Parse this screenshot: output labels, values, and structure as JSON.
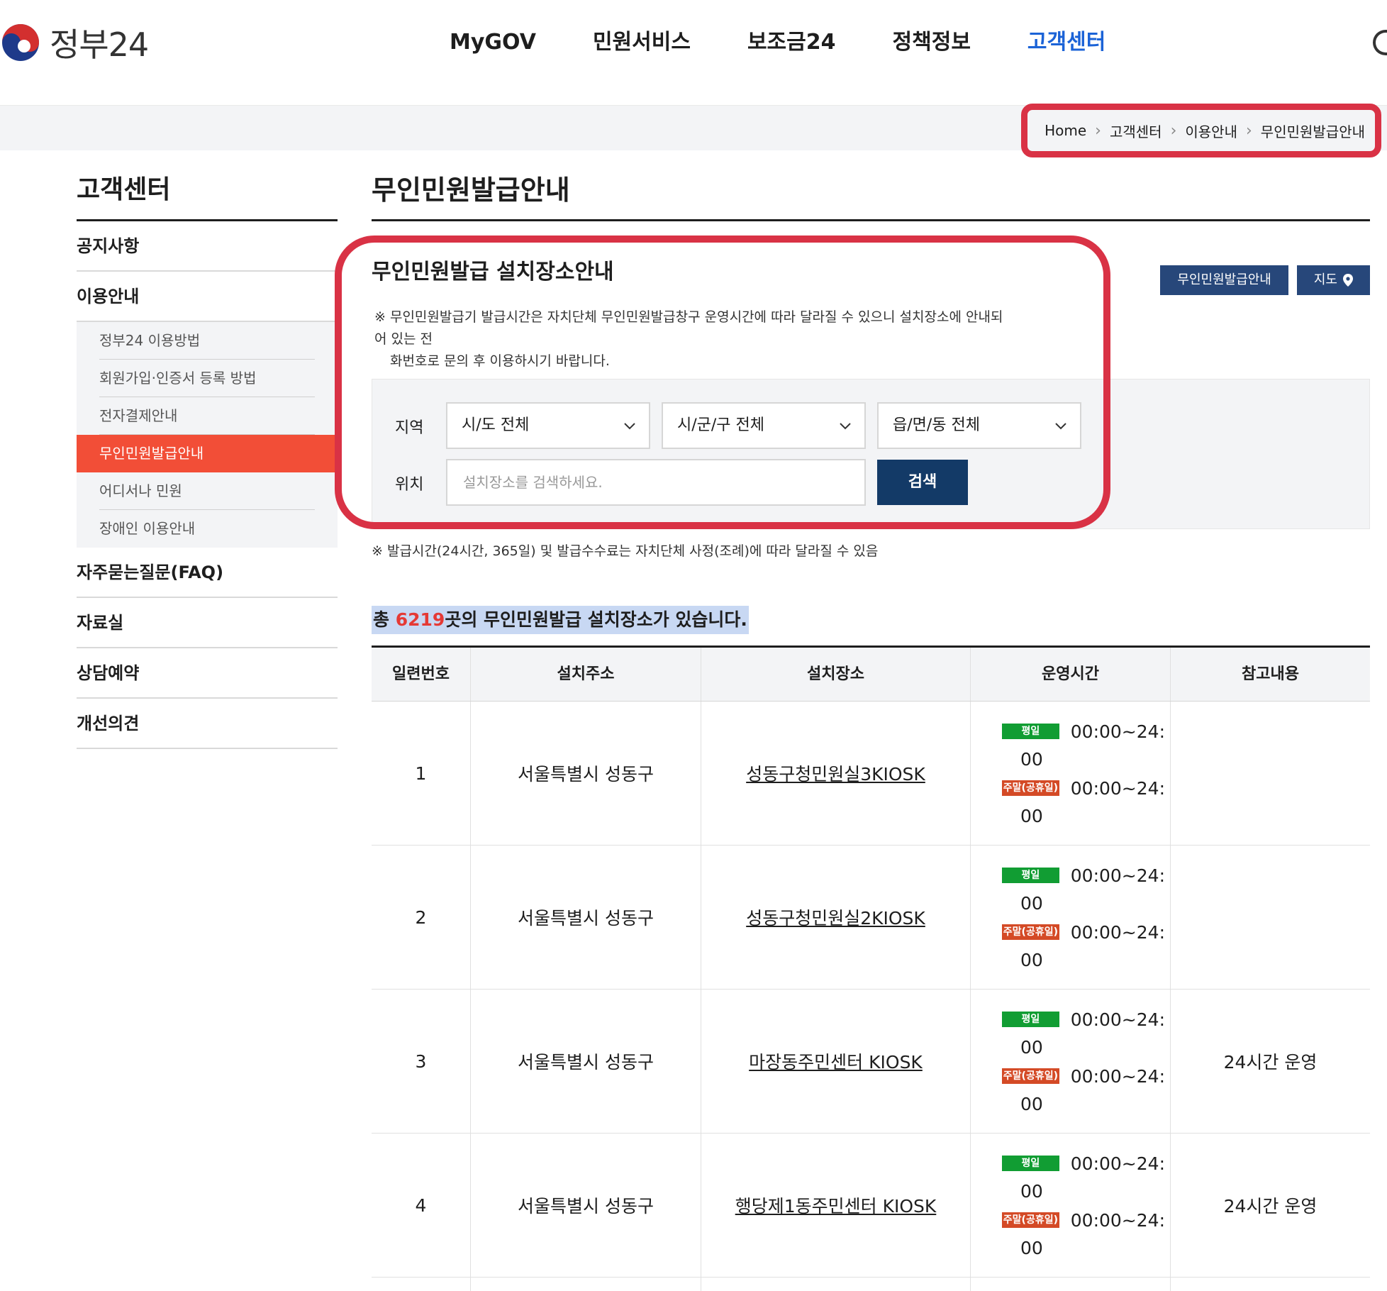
{
  "header": {
    "logo_text": "정부24",
    "nav": [
      {
        "label": "MyGOV",
        "active": false
      },
      {
        "label": "민원서비스",
        "active": false
      },
      {
        "label": "보조금24",
        "active": false
      },
      {
        "label": "정책정보",
        "active": false
      },
      {
        "label": "고객센터",
        "active": true
      }
    ]
  },
  "breadcrumb": [
    "Home",
    "고객센터",
    "이용안내",
    "무인민원발급안내"
  ],
  "sidebar": {
    "title": "고객센터",
    "items": [
      {
        "label": "공지사항"
      },
      {
        "label": "이용안내"
      },
      {
        "label": "자주묻는질문(FAQ)"
      },
      {
        "label": "자료실"
      },
      {
        "label": "상담예약"
      },
      {
        "label": "개선의견"
      }
    ],
    "sub_items": [
      {
        "label": "정부24 이용방법",
        "active": false
      },
      {
        "label": "회원가입·인증서 등록 방법",
        "active": false
      },
      {
        "label": "전자결제안내",
        "active": false
      },
      {
        "label": "무인민원발급안내",
        "active": true
      },
      {
        "label": "어디서나 민원",
        "active": false
      },
      {
        "label": "장애인 이용안내",
        "active": false
      }
    ]
  },
  "main": {
    "page_title": "무인민원발급안내",
    "section_title": "무인민원발급 설치장소안내",
    "notice_line1": "※ 무인민원발급기 발급시간은 자치단체 무인민원발급창구 운영시간에 따라 달라질 수 있으니 설치장소에 안내되어 있는 전",
    "notice_line2": "화번호로 문의 후 이용하시기 바랍니다.",
    "btn_guide": "무인민원발급안내",
    "btn_map": "지도",
    "search": {
      "region_label": "지역",
      "location_label": "위치",
      "sido": "시/도 전체",
      "sigungu": "시/군/구 전체",
      "eupmyeondong": "읍/면/동 전체",
      "placeholder": "설치장소를 검색하세요.",
      "button": "검색"
    },
    "foot_note": "※ 발급시간(24시간, 365일) 및 발급수수료는 자치단체 사정(조례)에 따라 달라질 수 있음",
    "total_prefix": "총 ",
    "total_count": "6219",
    "total_suffix": "곳의 무인민원발급 설치장소가 있습니다."
  },
  "table": {
    "headers": [
      "일련번호",
      "설치주소",
      "설치장소",
      "운영시간",
      "참고내용"
    ],
    "weekday_badge": "평일",
    "weekend_badge": "주말(공휴일)",
    "rows": [
      {
        "no": "1",
        "address": "서울특별시 성동구",
        "place": "성동구청민원실3KIOSK",
        "weekday": "00:00~24:",
        "weekday_tail": "00",
        "weekend": "00:00~24:",
        "weekend_tail": "00",
        "note": ""
      },
      {
        "no": "2",
        "address": "서울특별시 성동구",
        "place": "성동구청민원실2KIOSK",
        "weekday": "00:00~24:",
        "weekday_tail": "00",
        "weekend": "00:00~24:",
        "weekend_tail": "00",
        "note": ""
      },
      {
        "no": "3",
        "address": "서울특별시 성동구",
        "place": "마장동주민센터 KIOSK",
        "weekday": "00:00~24:",
        "weekday_tail": "00",
        "weekend": "00:00~24:",
        "weekend_tail": "00",
        "note": "24시간 운영"
      },
      {
        "no": "4",
        "address": "서울특별시 성동구",
        "place": "행당제1동주민센터 KIOSK",
        "weekday": "00:00~24:",
        "weekday_tail": "00",
        "weekend": "00:00~24:",
        "weekend_tail": "00",
        "note": "24시간 운영"
      }
    ]
  },
  "colors": {
    "accent_blue": "#1b63d7",
    "nav_active_bg": "#f24e37",
    "highlight_red": "#d93245",
    "button_navy": "#133a67",
    "badge_weekday": "#119d33",
    "badge_weekend": "#d44a26"
  }
}
